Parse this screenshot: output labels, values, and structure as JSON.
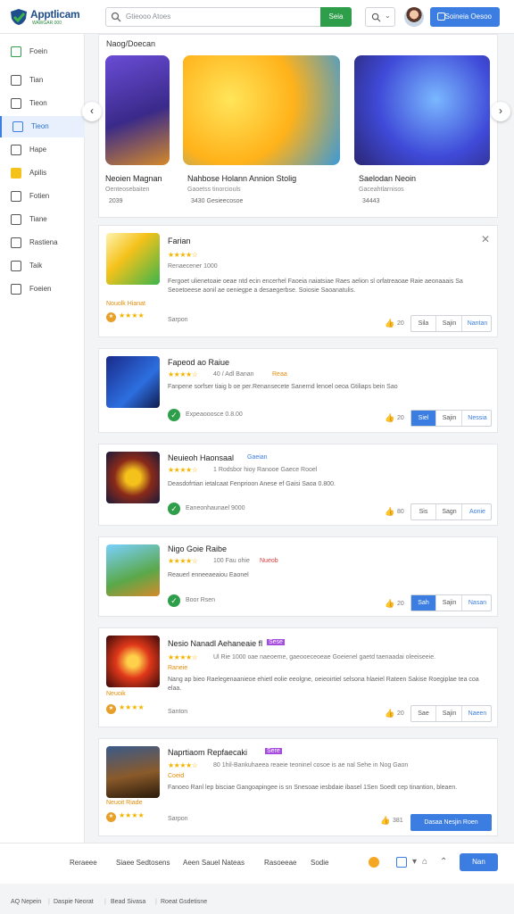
{
  "brand": {
    "name": "Apptlicam",
    "tagline": "WAWGAR 000"
  },
  "search": {
    "placeholder": "Gtieooo Atoes",
    "button": "Seia"
  },
  "header": {
    "cta": "Soineia Oesoo"
  },
  "sidebar": {
    "items": [
      {
        "label": "Foein"
      },
      {
        "label": "Tian"
      },
      {
        "label": "Tieon"
      },
      {
        "label": "Tieon"
      },
      {
        "label": "Hape"
      },
      {
        "label": "Apilis"
      },
      {
        "label": "Fotien"
      },
      {
        "label": "Tiane"
      },
      {
        "label": "Rastiena"
      },
      {
        "label": "Taik"
      },
      {
        "label": "Foeien"
      }
    ]
  },
  "featured": {
    "title": "Naog/Doecan",
    "cards": [
      {
        "name": "Neoien Magnan",
        "sub": "Oenteosebaiten",
        "meta": "2039"
      },
      {
        "name": "Nahbose Holann Annion Stolig",
        "sub": "Gaoetss tinorciouls",
        "meta": "3430   Gesieecosoe"
      },
      {
        "name": "Saelodan Neoin",
        "sub": "Gaceahtlarnisos",
        "meta": "34443"
      }
    ]
  },
  "apps": [
    {
      "title": "Farian",
      "rating_text": "Renaecener 1000",
      "desc": "Fergoet ulienetoaie oeae ntd ecin encerhel Faoeia naiatsiae Raes aelion sl orfatreaoae Raie aeonaaais Sa Seoetoeese aonil ae oeniegpe a desaegerbse. Soiosie Saoanatulis.",
      "tag": "Nouolk Hianat",
      "version": "Sarpon",
      "likes": "20",
      "btn1": "Sila",
      "btn2": "Sajin",
      "btn3": "Nantan"
    },
    {
      "title": "Fapeod ao Raiue",
      "rating_text": "40 / Adl Banan",
      "tag2": "Reaa",
      "desc": "Fanpene sorfser tiaig b oe per.Renansecete Sanernd lenoel oeoa Gtiliaps bein Sao",
      "version": "Expeaooosce   0.8.00",
      "likes": "20",
      "btn1": "Siel",
      "btn2": "Sajin",
      "btn3": "Nessia"
    },
    {
      "title": "Neuieoh Haonsaal",
      "tag2": "Gaeian",
      "rating_text": "1 Rodsbor hioy Ranooe Gaece Rooel",
      "desc": "Deasdofrtian ietalcaat  Fenprioon  Anese ef Gaisi Saoa 0.800.",
      "version": "Eaneonhaunael 9000",
      "likes": "80",
      "btn1": "Sis",
      "btn2": "Sagn",
      "btn3": "Aonie"
    },
    {
      "title": "Nigo Goie Raibe",
      "rating_text": "100 Fau ohie",
      "tag2": "Nueob",
      "desc": "Reauerl enneeaeaiou  Eaonel",
      "version": "Boor Rsen",
      "likes": "20",
      "btn1": "Sah",
      "btn2": "Sajin",
      "btn3": "Nasan"
    },
    {
      "title": "Nesio Nanadl Aehaneaie fl",
      "tag2": "Sese",
      "rating_text": "Ul Rie 1000 oae naeoeme, gaeooeceoeae Goeienel gaetd taenaadai oleeiseeie.",
      "tag3": "Raneie",
      "desc": "Nang ap bieo Raelegenaanieoe ehietl eolie eeolgne, oeieoirtiel selsona hlaeiel Rateen Sakise Roegiplae tea coa elaa.",
      "tag": "Neuoik",
      "version": "Santon",
      "likes": "20",
      "btn1": "Sae",
      "btn2": "Sajin",
      "btn3": "Naeen"
    },
    {
      "title": "Naprtiaom Repfaecaki",
      "tag2": "Sere",
      "rating_text": "80 1hil-Bankuhaeea reaeie teoninel cosoe is ae nal Sehe in Nog Gaon",
      "tag3": "Coeid",
      "desc": "Fanoeo Ranl lep bisciae Gangoapingee is sn Snesoae iesbdaie ibasel 1Sen Soedt cep tinantion, bleaen.",
      "tag": "Neuoit Riade",
      "version": "Sarpon",
      "likes": "381",
      "btn_primary": "Dasaa Nesjin Roen"
    }
  ],
  "footer": {
    "links": [
      "Reraeee",
      "Siaee Sedtosens",
      "Aeen Sauel Nateas",
      "Rasoeeae",
      "Sodie"
    ],
    "button": "Nan"
  },
  "bottom": {
    "links": [
      "AQ Nepein",
      "Daspie Neorat",
      "Bead Sivasa",
      "Roeat Gsdetisne"
    ]
  }
}
